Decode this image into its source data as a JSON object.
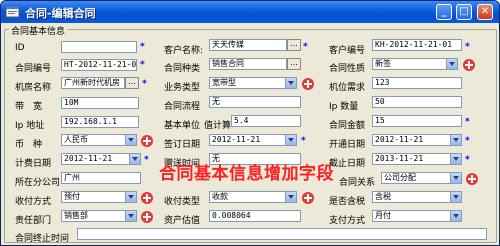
{
  "window": {
    "title": "合同-编辑合同"
  },
  "titlebar_buttons": {
    "minimize": "_",
    "maximize": "□",
    "close": "✕"
  },
  "group": {
    "legend": "合同基本信息"
  },
  "banner": "合同基本信息增加字段",
  "fields": {
    "id": {
      "label": "ID",
      "value": ""
    },
    "customer_name": {
      "label": "客户名称:",
      "value": "天天传媒"
    },
    "customer_no": {
      "label": "客户编号",
      "value": "KH-2012-11-21-01"
    },
    "contract_no": {
      "label": "合同编号",
      "value": "HT-2012-11-21-01"
    },
    "contract_type": {
      "label": "合同种类",
      "value": "销售合同"
    },
    "contract_nature": {
      "label": "合同性质",
      "value": "新签"
    },
    "org_name": {
      "label": "机房名称",
      "value": "广州新时代机房"
    },
    "business_type": {
      "label": "业务类型",
      "value": "宽带型"
    },
    "cabinet_demand": {
      "label": "机位需求",
      "value": "123"
    },
    "bandwidth": {
      "label": "带　宽",
      "value": "10M"
    },
    "contract_flow": {
      "label": "合同流程",
      "value": "无"
    },
    "ip_count": {
      "label": "Ip 数量",
      "value": "50"
    },
    "ip_address": {
      "label": "Ip 地址",
      "value": "192.168.1.1"
    },
    "unit_price": {
      "label": "基本单位",
      "value": "5.4",
      "label2": "值计算"
    },
    "contract_amount": {
      "label": "合同金额",
      "value": "15"
    },
    "currency": {
      "label": "币　种",
      "value": "人民币"
    },
    "sign_date": {
      "label": "签订日期",
      "value": "2012-11-21"
    },
    "open_date": {
      "label": "开通日期",
      "value": "2012-11-21"
    },
    "billing_date": {
      "label": "计费日期",
      "value": "2012-11-21"
    },
    "gift_time": {
      "label": "赠送时间",
      "value": "无"
    },
    "end_date": {
      "label": "截止日期",
      "value": "2013-11-21"
    },
    "branch": {
      "label": "所在分公司",
      "value": "广州"
    },
    "contract_relation": {
      "label": "合同关系",
      "value": "公司分配"
    },
    "collect_method": {
      "label": "收付方式",
      "value": "预付"
    },
    "collect_type": {
      "label": "收付类型",
      "value": "收款"
    },
    "tax_included": {
      "label": "是否含税",
      "value": "含税"
    },
    "department": {
      "label": "责任部门",
      "value": "销售部"
    },
    "asset_value": {
      "label": "资产估值",
      "value": "0.008064"
    },
    "payment_method": {
      "label": "支付方式",
      "value": "月付"
    },
    "termination_time": {
      "label": "合同终止时间",
      "value": ""
    }
  },
  "ellipsis": "...",
  "required_mark": "*"
}
